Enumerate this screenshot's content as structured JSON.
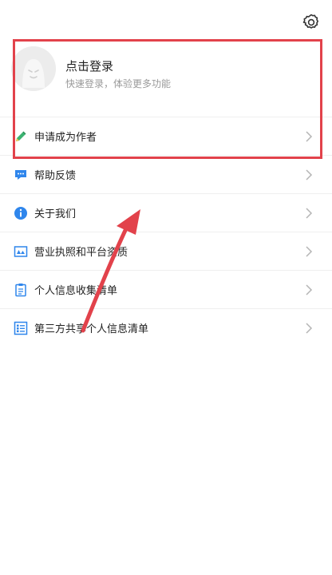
{
  "profile": {
    "title": "点击登录",
    "subtitle": "快速登录，体验更多功能"
  },
  "menu": {
    "items": [
      {
        "label": "申请成为作者",
        "icon": "pencil-icon"
      },
      {
        "label": "帮助反馈",
        "icon": "chat-bubble-icon"
      },
      {
        "label": "关于我们",
        "icon": "info-icon"
      },
      {
        "label": "营业执照和平台资质",
        "icon": "license-icon"
      },
      {
        "label": "个人信息收集清单",
        "icon": "clipboard-list-icon"
      },
      {
        "label": "第三方共享个人信息清单",
        "icon": "checklist-icon"
      }
    ]
  },
  "colors": {
    "accent_blue": "#2f86ec",
    "green": "#3cb371",
    "annotation_red": "#e2424b"
  }
}
